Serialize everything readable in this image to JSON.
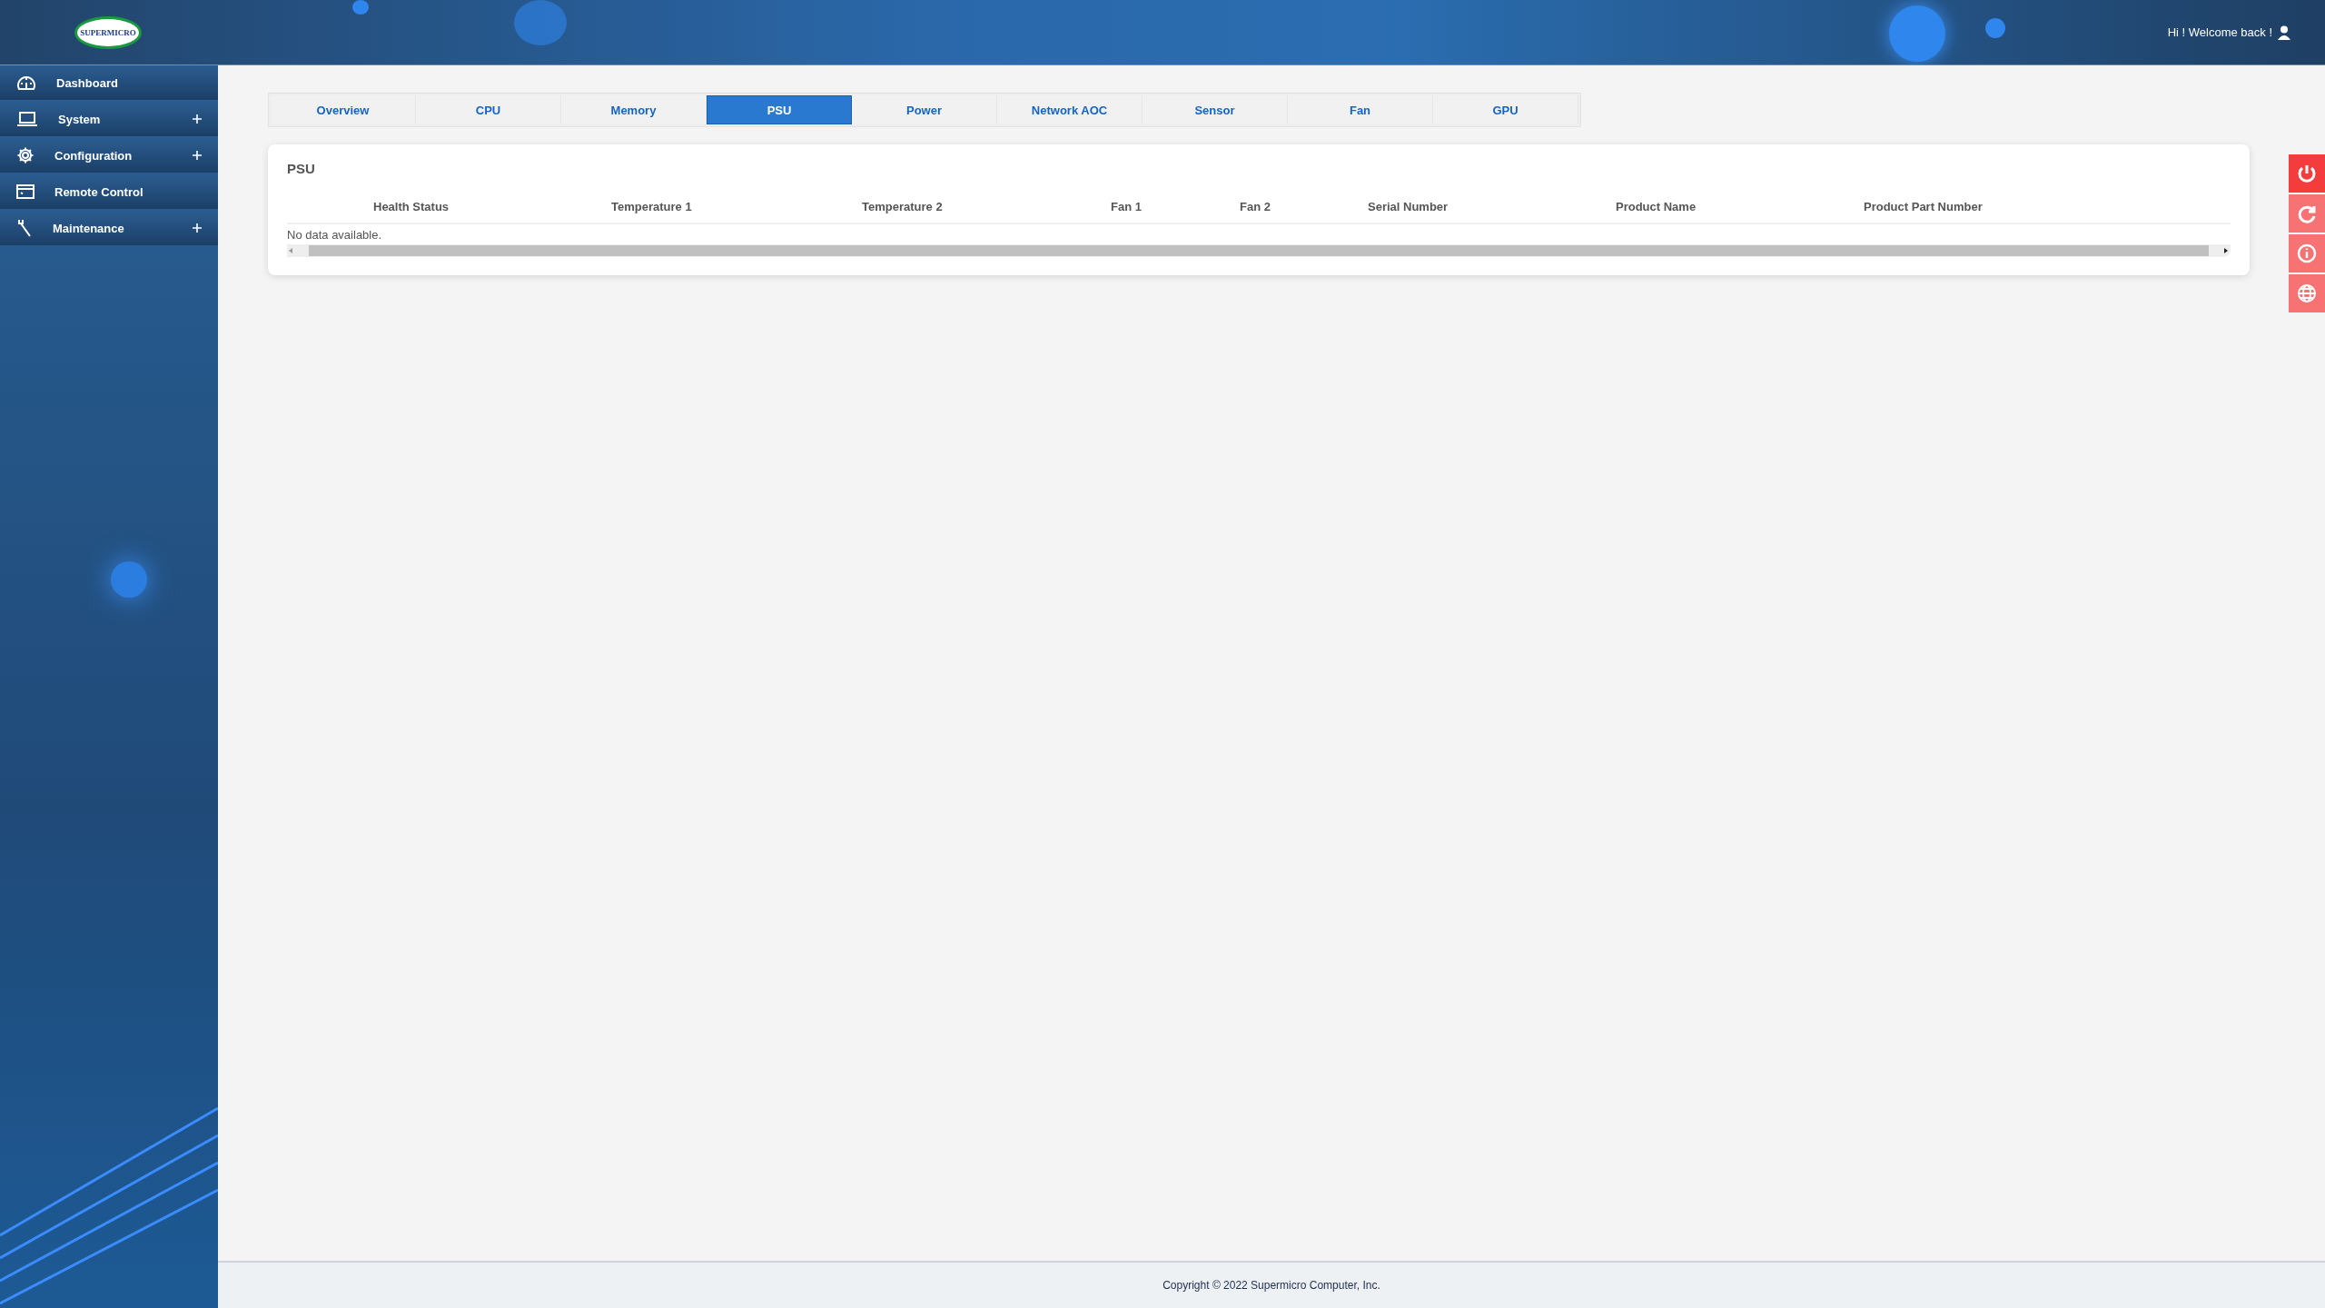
{
  "header": {
    "logo": "SUPERMICRO",
    "greeting": "Hi ! Welcome back !"
  },
  "sidebar": {
    "items": [
      {
        "label": "Dashboard",
        "kind": "gauge",
        "expandable": false
      },
      {
        "label": "System",
        "kind": "laptop",
        "expandable": true
      },
      {
        "label": "Configuration",
        "kind": "gear",
        "expandable": true
      },
      {
        "label": "Remote Control",
        "kind": "console",
        "expandable": false
      },
      {
        "label": "Maintenance",
        "kind": "wrench",
        "expandable": true
      }
    ]
  },
  "tabs": [
    {
      "label": "Overview",
      "selected": false
    },
    {
      "label": "CPU",
      "selected": false
    },
    {
      "label": "Memory",
      "selected": false
    },
    {
      "label": "PSU",
      "selected": true
    },
    {
      "label": "Power",
      "selected": false
    },
    {
      "label": "Network AOC",
      "selected": false
    },
    {
      "label": "Sensor",
      "selected": false
    },
    {
      "label": "Fan",
      "selected": false
    },
    {
      "label": "GPU",
      "selected": false
    }
  ],
  "panel": {
    "title": "PSU",
    "table": {
      "columns": [
        "Health Status",
        "Temperature 1",
        "Temperature 2",
        "Fan 1",
        "Fan 2",
        "Serial Number",
        "Product Name",
        "Product Part Number"
      ],
      "empty_message": "No data available."
    }
  },
  "side_actions": [
    {
      "kind": "power"
    },
    {
      "kind": "refresh"
    },
    {
      "kind": "info"
    },
    {
      "kind": "language"
    }
  ],
  "footer": {
    "copyright": "Copyright © 2022 Supermicro Computer, Inc."
  }
}
